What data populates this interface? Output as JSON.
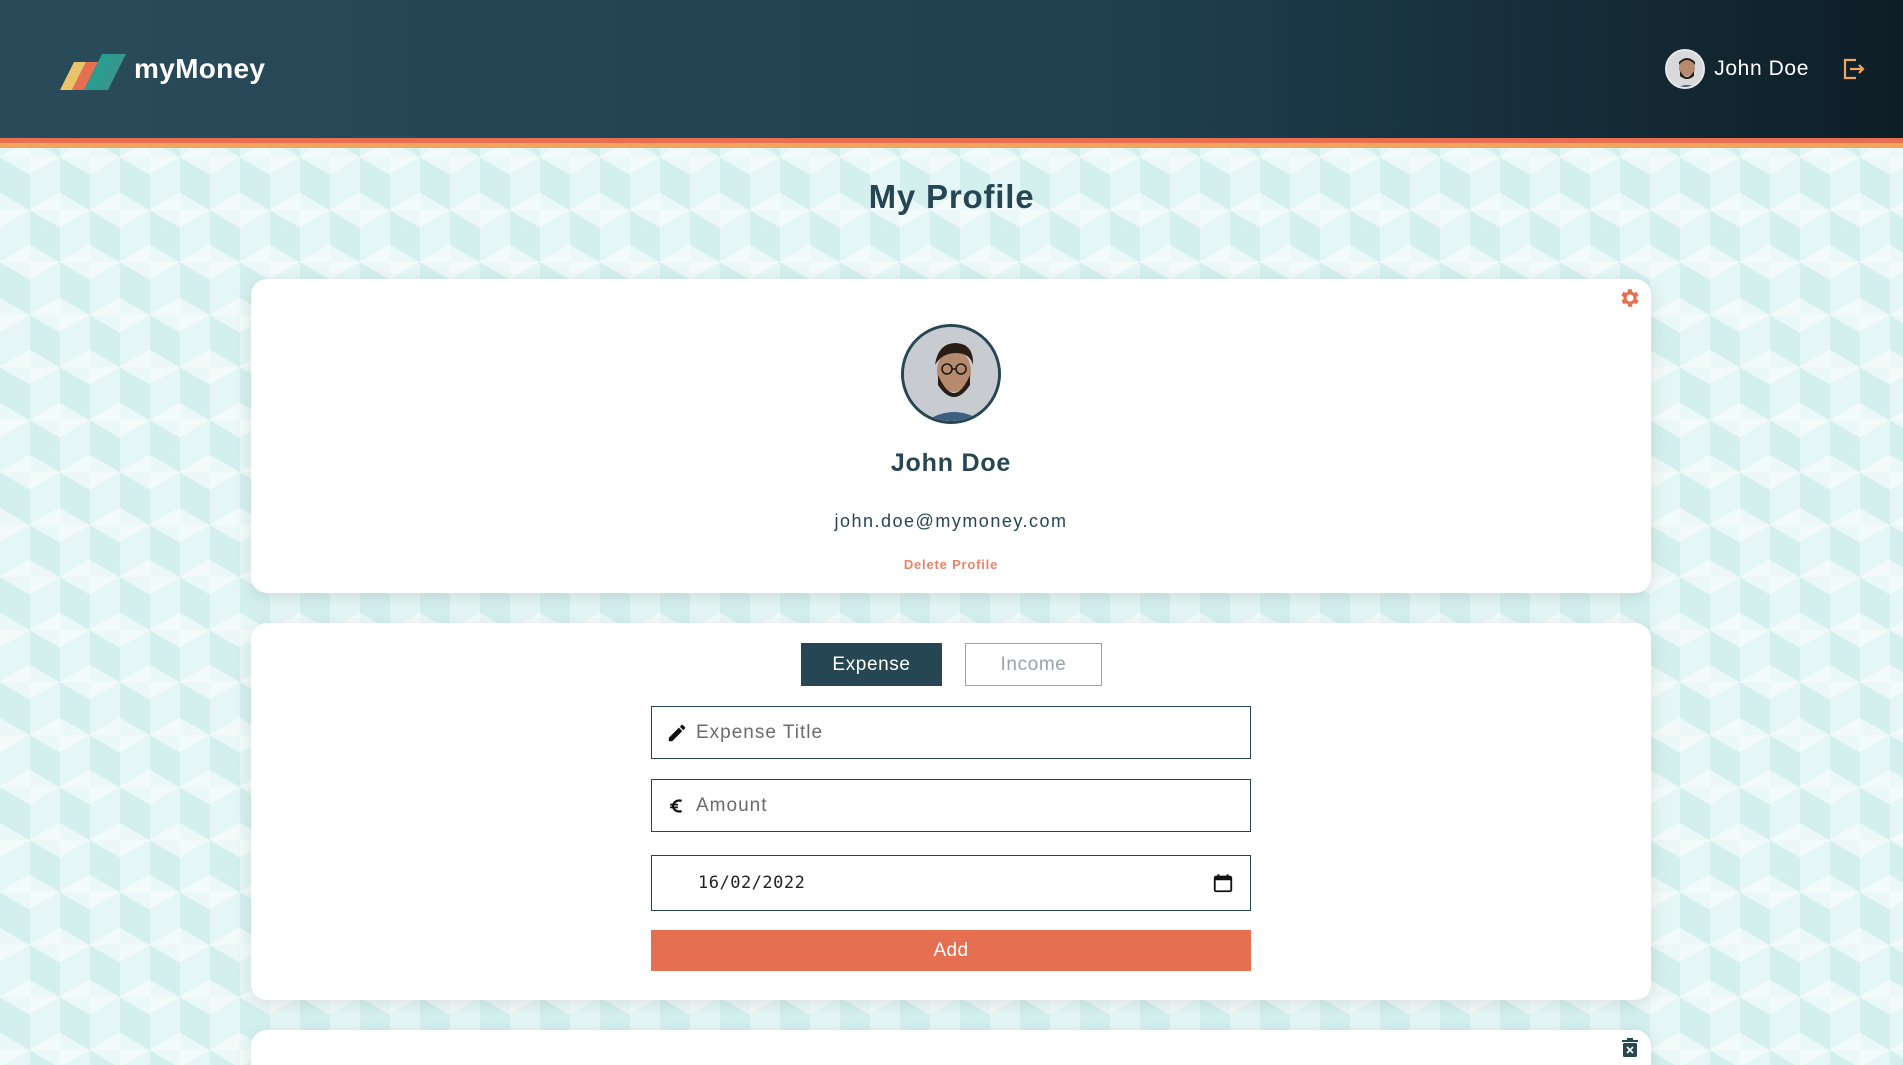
{
  "header": {
    "brand": "myMoney",
    "username": "John Doe",
    "logout_icon": "logout-icon"
  },
  "page": {
    "title": "My Profile"
  },
  "profile": {
    "name": "John Doe",
    "email": "john.doe@mymoney.com",
    "delete_label": "Delete Profile",
    "settings_icon": "gear-icon"
  },
  "transaction_form": {
    "tabs": [
      {
        "label": "Expense",
        "active": true
      },
      {
        "label": "Income",
        "active": false
      }
    ],
    "title_placeholder": "Expense Title",
    "amount_placeholder": "Amount",
    "date_value": "16/02/2022",
    "add_label": "Add"
  },
  "colors": {
    "primary": "#264653",
    "accent": "#e76f51",
    "stripe_secondary": "#f2a55a",
    "background": "#e4f6f5"
  }
}
